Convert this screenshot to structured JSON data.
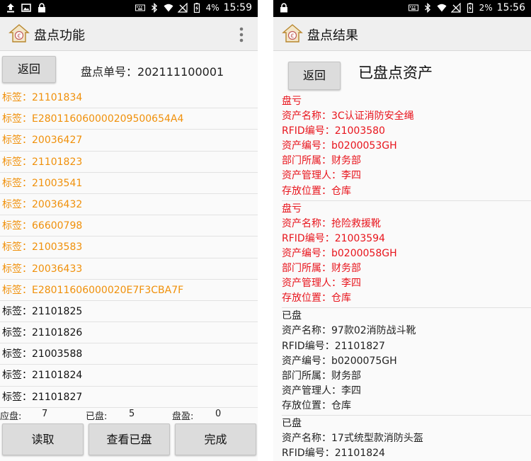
{
  "left_screen": {
    "status": {
      "battery": "4%",
      "time": "15:59"
    },
    "title": "盘点功能",
    "back_label": "返回",
    "order_label": "盘点单号：",
    "order_number": "202111100001",
    "tag_prefix": "标签：",
    "tags": [
      {
        "code": "21101834",
        "state": "pending"
      },
      {
        "code": "E280116060000209500654A4",
        "state": "pending"
      },
      {
        "code": "20036427",
        "state": "pending"
      },
      {
        "code": "21101823",
        "state": "pending"
      },
      {
        "code": "21003541",
        "state": "pending"
      },
      {
        "code": "20036432",
        "state": "pending"
      },
      {
        "code": "66600798",
        "state": "pending"
      },
      {
        "code": "21003583",
        "state": "pending"
      },
      {
        "code": "20036433",
        "state": "pending"
      },
      {
        "code": "E28011606000020E7F3CBA7F",
        "state": "pending"
      },
      {
        "code": "21101825",
        "state": "done"
      },
      {
        "code": "21101826",
        "state": "done"
      },
      {
        "code": "21003588",
        "state": "done"
      },
      {
        "code": "21101824",
        "state": "done"
      },
      {
        "code": "21101827",
        "state": "done"
      }
    ],
    "counts": {
      "expected_label": "应盘:",
      "expected_value": "7",
      "done_label": "已盘:",
      "done_value": "5",
      "surplus_label": "盘盈:",
      "surplus_value": "0"
    },
    "buttons": {
      "read": "读取",
      "view_done": "查看已盘",
      "finish": "完成"
    }
  },
  "right_screen": {
    "status": {
      "battery": "2%",
      "time": "15:56"
    },
    "title": "盘点结果",
    "back_label": "返回",
    "heading": "已盘点资产",
    "groups": [
      {
        "status": "盘亏",
        "type": "loss",
        "lines": [
          "资产名称：3C认证消防安全绳",
          "RFID编号：21003580",
          "资产编号：b0200053GH",
          "部门所属：财务部",
          "资产管理人：李四",
          "存放位置：仓库"
        ]
      },
      {
        "status": "盘亏",
        "type": "loss",
        "lines": [
          "资产名称：抢险救援靴",
          "RFID编号：21003594",
          "资产编号：b0200058GH",
          "部门所属：财务部",
          "资产管理人：李四",
          "存放位置：仓库"
        ]
      },
      {
        "status": "已盘",
        "type": "ok",
        "lines": [
          "资产名称：97款02消防战斗靴",
          "RFID编号：21101827",
          "资产编号：b0200075GH",
          "部门所属：财务部",
          "资产管理人：李四",
          "存放位置：仓库"
        ]
      },
      {
        "status": "已盘",
        "type": "ok",
        "lines": [
          "资产名称：17式统型款消防头盔",
          "RFID编号：21101824"
        ]
      }
    ]
  },
  "colors": {
    "pending_tag": "#f0900a",
    "loss": "#e8141c",
    "status_bar": "#000000",
    "app_bar": "#efefef",
    "button": "#dcdcdc"
  }
}
